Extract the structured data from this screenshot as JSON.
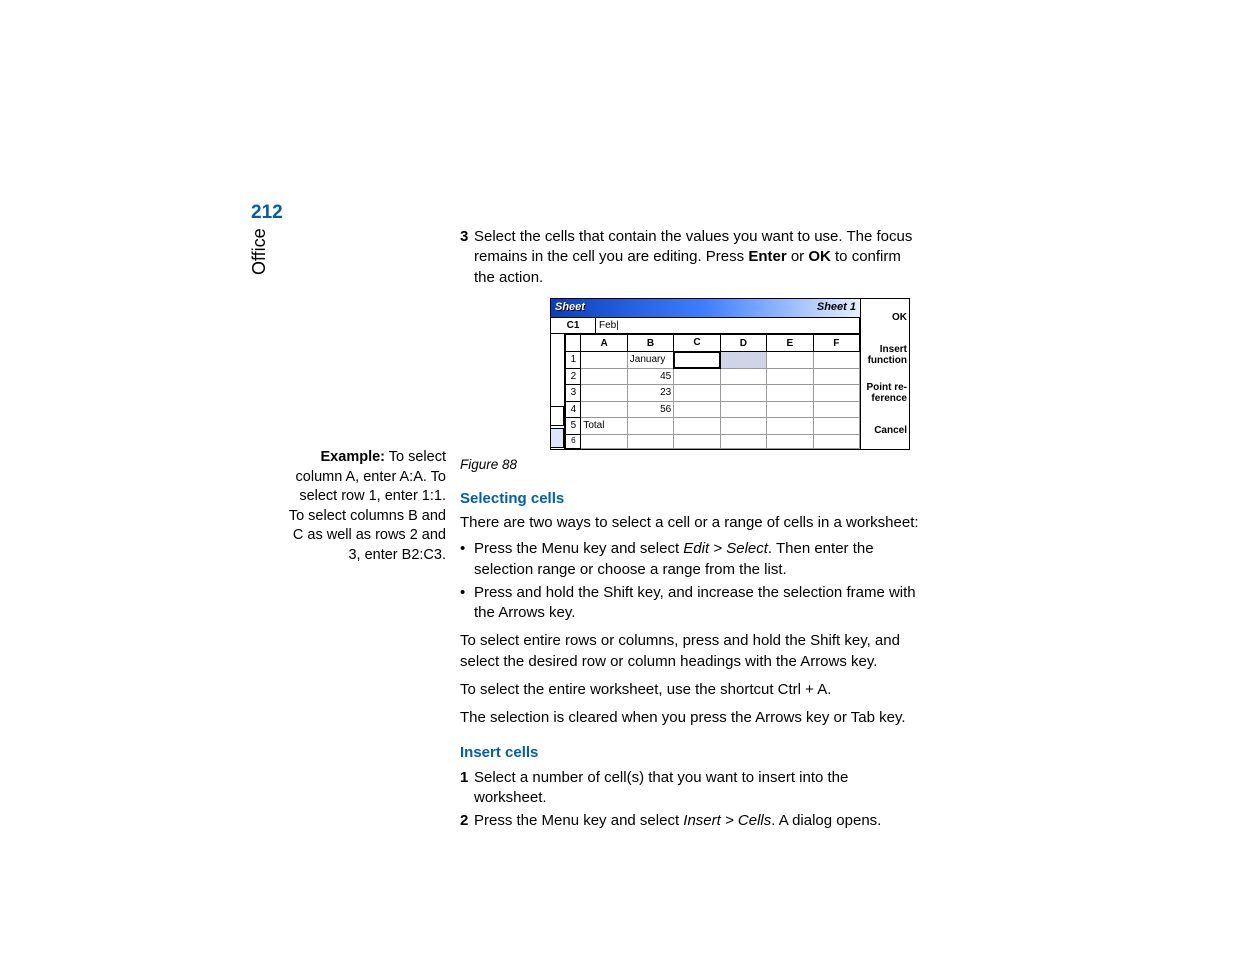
{
  "meta": {
    "page_number": "212",
    "section": "Office"
  },
  "step3": {
    "num": "3",
    "text_before_b1": "Select the cells that contain the values you want to use. The focus remains in the cell you are editing. Press ",
    "b1": "Enter",
    "mid": " or ",
    "b2": "OK",
    "after": " to confirm the action."
  },
  "figure": {
    "caption": "Figure 88",
    "title_left": "Sheet",
    "title_right": "Sheet 1",
    "cell_ref": "C1",
    "formula_value": "Feb|",
    "col_headers": [
      "A",
      "B",
      "C",
      "D",
      "E",
      "F"
    ],
    "rows": [
      {
        "n": "1",
        "cells": [
          "",
          "January",
          "",
          "",
          "",
          ""
        ]
      },
      {
        "n": "2",
        "cells": [
          "",
          "45",
          "",
          "",
          "",
          ""
        ]
      },
      {
        "n": "3",
        "cells": [
          "",
          "23",
          "",
          "",
          "",
          ""
        ]
      },
      {
        "n": "4",
        "cells": [
          "",
          "56",
          "",
          "",
          "",
          ""
        ]
      },
      {
        "n": "5",
        "cells": [
          "Total",
          "",
          "",
          "",
          "",
          ""
        ]
      },
      {
        "n": "6",
        "cells": [
          "",
          "",
          "",
          "",
          "",
          ""
        ]
      }
    ],
    "softkeys": {
      "ok": "OK",
      "insert": "Insert function",
      "pointref": "Point re- ference",
      "cancel": "Cancel"
    }
  },
  "selecting": {
    "heading": "Selecting cells",
    "intro": "There are two ways to select a cell or a range of cells in a worksheet:",
    "bullet1_before": "Press the Menu key and select ",
    "bullet1_italic": "Edit > Select",
    "bullet1_after": ". Then enter the selection range or choose a range from the list.",
    "bullet2": "Press and hold the Shift key, and increase the selection frame with the Arrows key.",
    "para1": "To select entire rows or columns, press and hold the Shift key, and select the desired row or column headings with the Arrows key.",
    "para2": "To select the entire worksheet, use the shortcut Ctrl + A.",
    "para3": "The selection is cleared when you press the Arrows key or Tab key."
  },
  "example": {
    "label": "Example:",
    "text": " To select column A, enter A:A. To select row 1, enter 1:1. To select columns B and C as well as rows 2 and 3, enter B2:C3."
  },
  "insert": {
    "heading": "Insert cells",
    "step1_num": "1",
    "step1": "Select a number of cell(s) that you want to insert into the worksheet.",
    "step2_num": "2",
    "step2_before": "Press the Menu key and select ",
    "step2_italic": "Insert > Cells",
    "step2_after": ". A dialog opens."
  }
}
